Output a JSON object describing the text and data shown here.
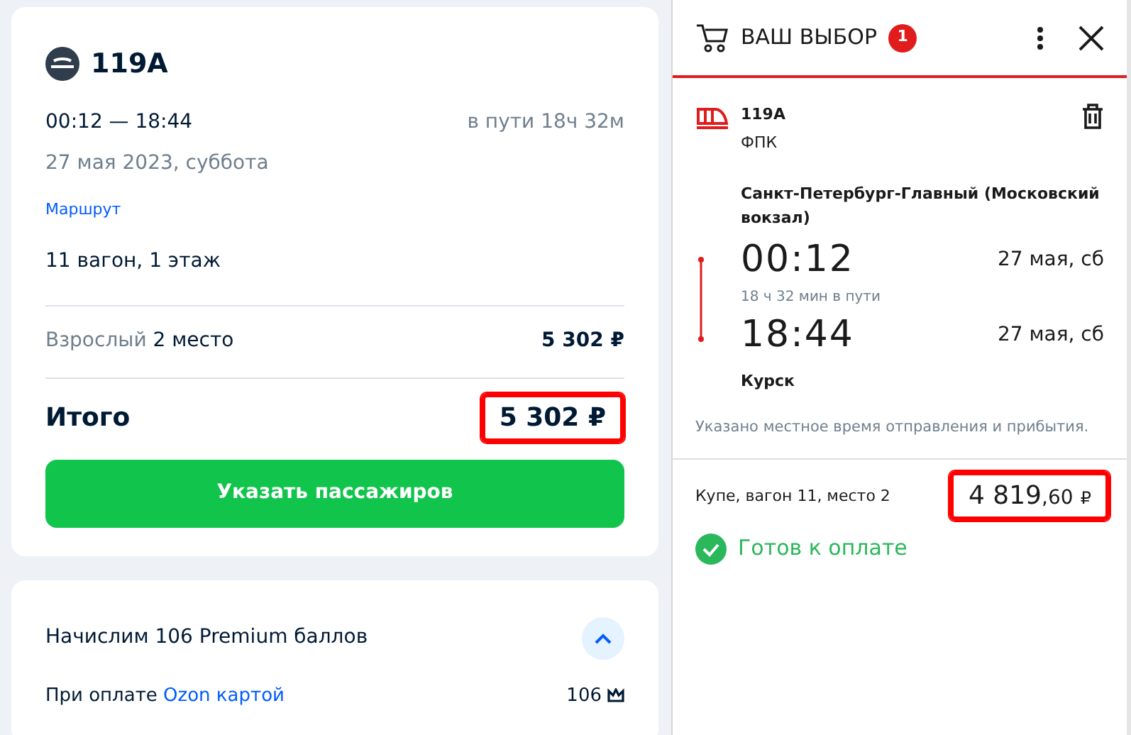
{
  "ticket": {
    "train": "119A",
    "times": "00:12 — 18:44",
    "duration": "в пути 18ч 32м",
    "date": "27 мая 2023, суббота",
    "route_link": "Маршрут",
    "car": "11 вагон, 1 этаж",
    "passenger": {
      "type": "Взрослый",
      "seat": "2 место",
      "price": "5 302 ₽"
    },
    "total": {
      "label": "Итого",
      "price": "5 302 ₽",
      "highlighted": true
    },
    "button": "Указать пассажиров"
  },
  "bonus": {
    "title": "Начислим 106 Premium баллов",
    "expanded": true,
    "note": "При оплате",
    "link": "Ozon картой",
    "points": "106"
  },
  "cart": {
    "title": "ВАШ ВЫБОР",
    "count": "1",
    "item": {
      "train": "119A",
      "carrier": "ФПК",
      "from": "Санкт-Петербург-Главный (Московский вокзал)",
      "dep_time": "00:12",
      "dep_date": "27 мая, сб",
      "duration": "18 ч 32 мин в пути",
      "arr_time": "18:44",
      "arr_date": "27 мая, сб",
      "to": "Курск",
      "note": "Указано местное время отправления и прибытия."
    },
    "seat": "Купе, вагон 11, место 2",
    "price": {
      "amount": "4 819",
      "cents": ",60",
      "currency": "₽",
      "highlighted": true
    },
    "status": "Готов к оплате"
  }
}
